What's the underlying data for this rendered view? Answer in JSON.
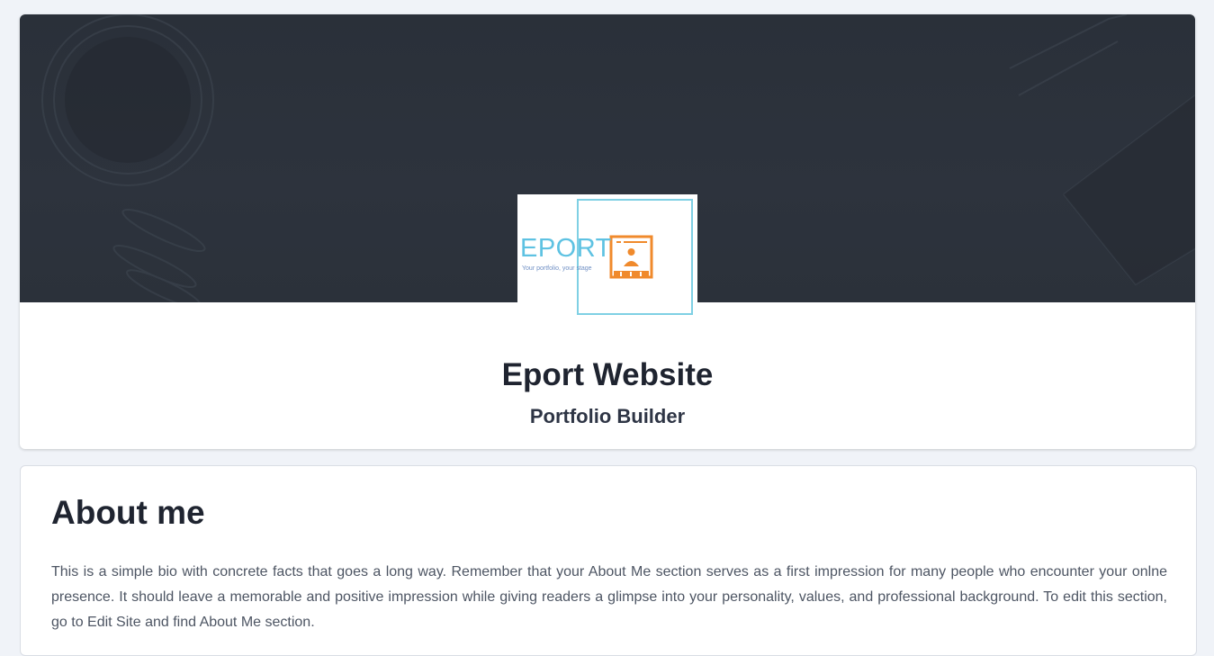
{
  "header": {
    "logo_alt": "EPORT logo",
    "logo_word": "EPORT",
    "logo_tagline": "Your portfolio, your stage",
    "site_title": "Eport Website",
    "site_subtitle": "Portfolio Builder",
    "colors": {
      "cover": "#2b313a",
      "logo_blue": "#5ec2e2",
      "logo_orange": "#f08a2c"
    }
  },
  "about": {
    "heading": "About me",
    "body": "This is a simple bio with concrete facts that goes a long way. Remember that your About Me section serves as a first impression for many people who encounter your onlne presence. It should leave a memorable and positive impression while giving readers a glimpse into your personality, values, and professional background. To edit this section, go to Edit Site and find About Me section."
  }
}
